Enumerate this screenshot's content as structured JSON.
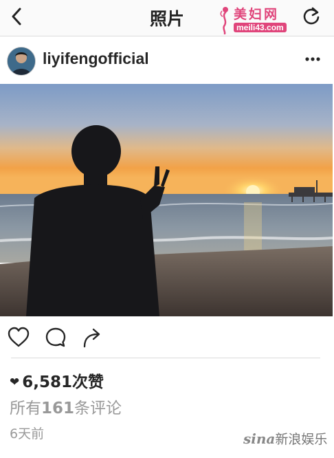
{
  "nav": {
    "title": "照片",
    "back_icon": "chevron-left-icon",
    "refresh_icon": "refresh-icon"
  },
  "watermark_top": {
    "line1": "美妇网",
    "line2": "meili43.com"
  },
  "post": {
    "username": "liyifengofficial",
    "more_icon": "more-dots-icon",
    "photo_alt": "Silhouette of a man making a peace sign on a beach at sunset with a pier"
  },
  "actions": {
    "like_icon": "heart-outline-icon",
    "comment_icon": "comment-bubble-icon",
    "share_icon": "share-arrow-icon"
  },
  "stats": {
    "likes_count": "6,581",
    "likes_suffix": "次赞",
    "comments_prefix": "所有",
    "comments_count": "161",
    "comments_suffix": "条评论",
    "time_ago": "6天前"
  },
  "watermark_bottom": {
    "logo": "sina",
    "text": "新浪娱乐"
  },
  "colors": {
    "nav_bg": "#fafafa",
    "text": "#262626",
    "muted": "#999999",
    "watermark_pink": "#e0457b"
  }
}
